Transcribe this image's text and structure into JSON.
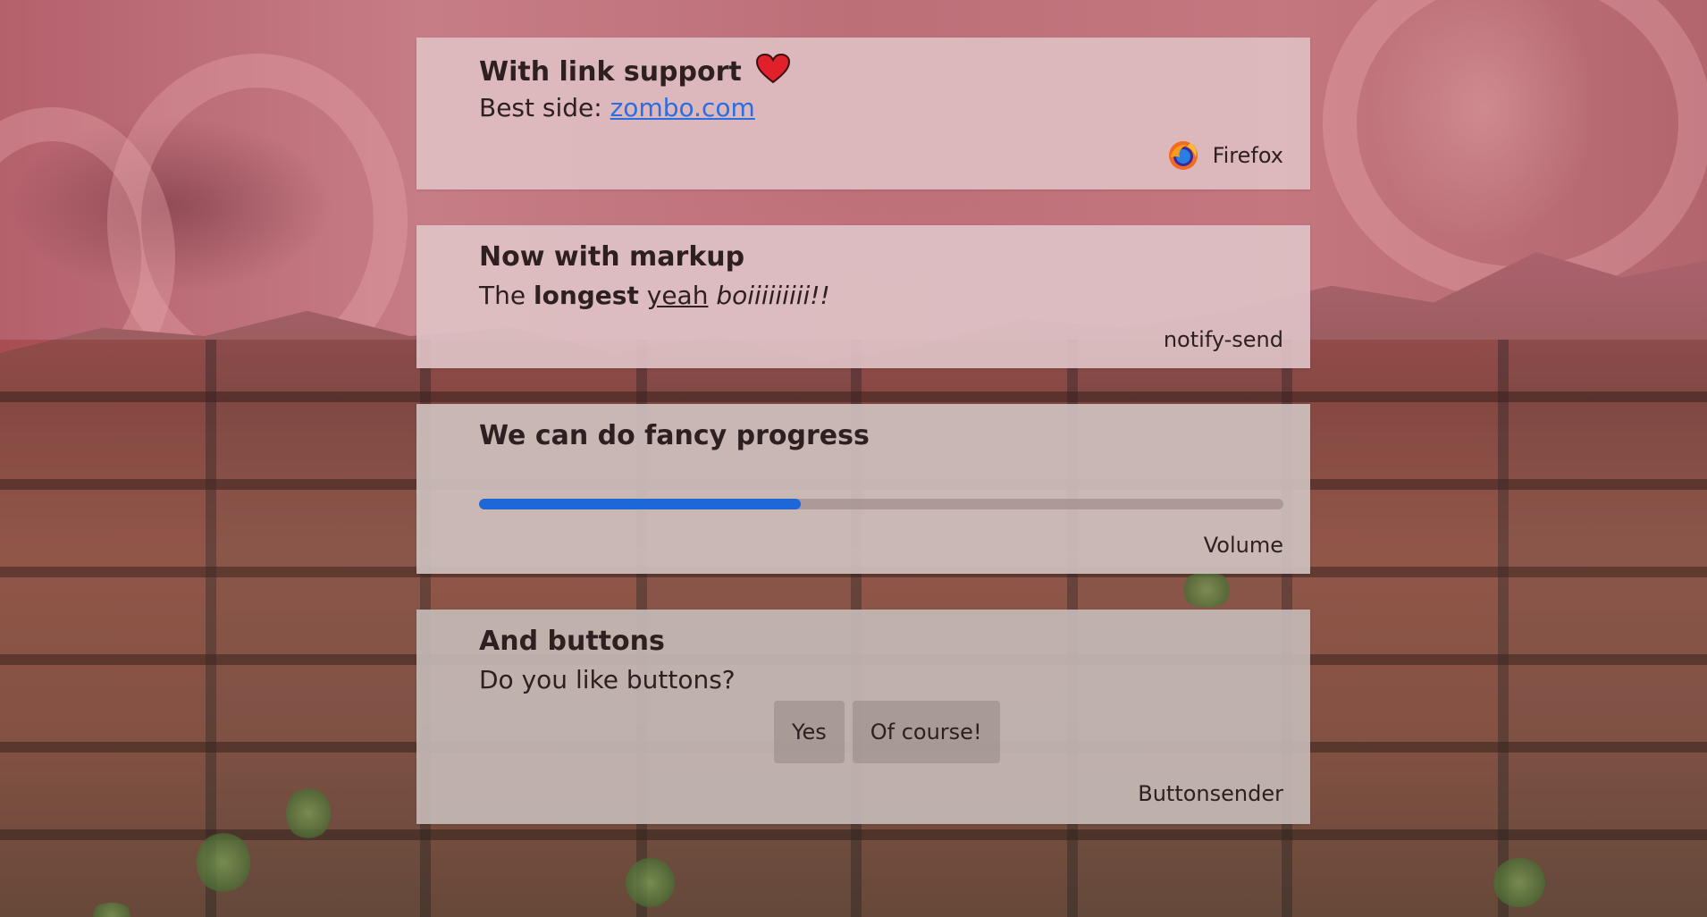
{
  "notifications": [
    {
      "summary": "With link support",
      "body_prefix": "Best side: ",
      "link": "zombo.com",
      "app_name": "Firefox",
      "icon": "firefox-icon",
      "emoji": "heart-icon"
    },
    {
      "summary": "Now with markup",
      "body": {
        "part1": "The ",
        "bold": "longest",
        "space1": " ",
        "underline": "yeah",
        "space2": " ",
        "italic": "boiiiiiiiii!!"
      },
      "app_name": "notify-send"
    },
    {
      "summary": "We can do fancy progress",
      "progress": 0.4,
      "app_name": "Volume"
    },
    {
      "summary": "And buttons",
      "body": "Do you like buttons?",
      "actions": [
        "Yes",
        "Of course!"
      ],
      "app_name": "Buttonsender"
    }
  ],
  "colors": {
    "accent": "#1d67d6",
    "link": "#2a6ee0",
    "heart": "#e0202a"
  }
}
